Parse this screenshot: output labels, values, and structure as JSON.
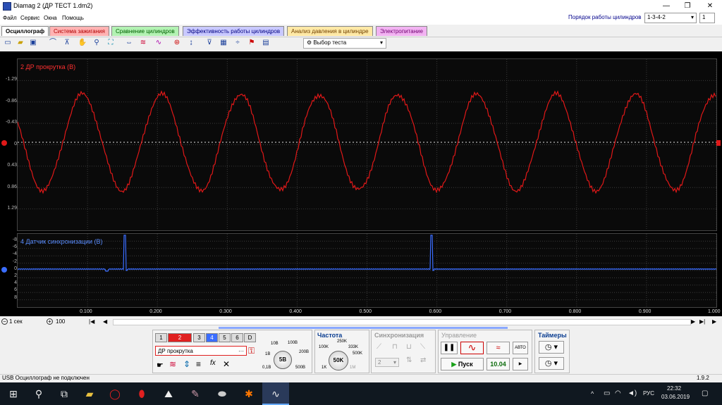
{
  "window": {
    "title": "Diamag 2 (ДР ТЕСТ 1.dm2)",
    "minimize": "—",
    "maximize": "❐",
    "close": "✕"
  },
  "menu": [
    "Файл",
    "Сервис",
    "Окна",
    "Помощь"
  ],
  "cylinder_order": {
    "label": "Порядок работы цилиндров",
    "value": "1-3-4-2",
    "number": "1"
  },
  "tabs": [
    {
      "label": "Осциллограф",
      "color": "#ffffff"
    },
    {
      "label": "Система зажигания",
      "color": "#ffb3b3"
    },
    {
      "label": "Сравнение цилиндров",
      "color": "#b3f2b3"
    },
    {
      "label": "Эффективность работы цилиндров",
      "color": "#c9c9ff"
    },
    {
      "label": "Анализ давления в цилиндре",
      "color": "#ffe9a6"
    },
    {
      "label": "Электропитание",
      "color": "#f2b3f2"
    }
  ],
  "toolbar": {
    "test_select": "Выбор теста"
  },
  "channel1": {
    "label": "2 ДР прокрутка (В)",
    "color": "#e01818",
    "yticks": [
      "-1.29",
      "-0.86",
      "-0.43",
      "0",
      "0.43",
      "0.86",
      "1.29"
    ]
  },
  "channel2": {
    "label": "4 Датчик синхронизации (В)",
    "color": "#3a6dff",
    "yticks": [
      "-8",
      "-6",
      "-4",
      "-2",
      "0",
      "2",
      "4",
      "6",
      "8"
    ]
  },
  "xticks": [
    "0.100",
    "0.200",
    "0.300",
    "0.400",
    "0.500",
    "0.600",
    "0.700",
    "0.800",
    "0.900",
    "1.000"
  ],
  "scroll": {
    "timebase": "1 сек",
    "zoom": "100"
  },
  "channels_buttons": [
    "1",
    "2",
    "3",
    "4",
    "5",
    "6",
    "D"
  ],
  "channel_name": "ДР прокрутка",
  "voltage": {
    "center": "5В",
    "labels": [
      "10В",
      "100В",
      "200В",
      "1В",
      "500В",
      "0,1В"
    ]
  },
  "frequency": {
    "title": "Частота",
    "center": "50K",
    "labels": [
      "250K",
      "100K",
      "333K",
      "500K",
      "1K",
      "1M"
    ]
  },
  "sync": {
    "title": "Синхронизация",
    "value": "2"
  },
  "control": {
    "title": "Управление",
    "start": "Пуск",
    "value": "10.04",
    "auto": "АВТО"
  },
  "timers": {
    "title": "Таймеры"
  },
  "status": {
    "text": "USB Осциллограф не подключен",
    "version": "1.9.2"
  },
  "taskbar": {
    "time": "22:32",
    "date": "03.06.2019",
    "lang": "РУС"
  }
}
